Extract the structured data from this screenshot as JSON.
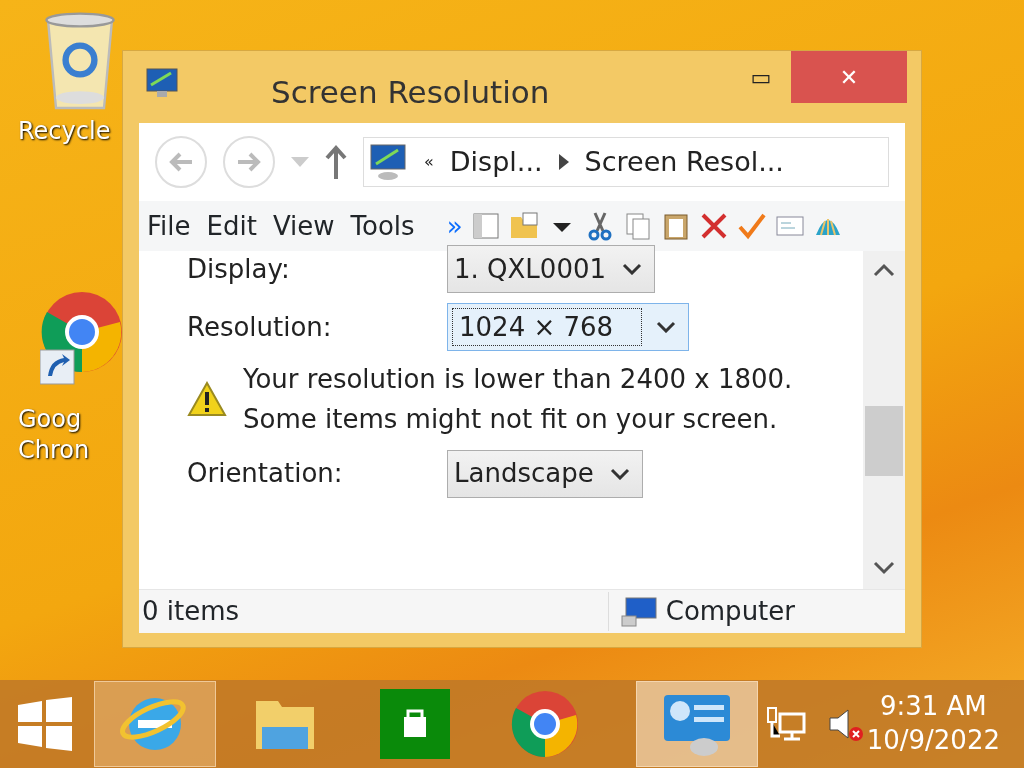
{
  "desktop_icons": [
    {
      "kind": "recycle",
      "lines": [
        "Recycle"
      ]
    },
    {
      "kind": "chrome",
      "lines": [
        "Goog",
        "Chron"
      ]
    }
  ],
  "window": {
    "title": "Screen Resolution",
    "minimize": "▭",
    "close": "✕"
  },
  "address_bar": {
    "overflow": "«",
    "crumbs": [
      "Displ...",
      "Screen Resol..."
    ],
    "back_disabled": true,
    "forward_disabled": true
  },
  "menu": [
    "File",
    "Edit",
    "View",
    "Tools"
  ],
  "toolbar_overflow": "»",
  "settings": [
    {
      "kind": "select",
      "label": "Display:",
      "value": "1. QXL0001",
      "focused": false
    },
    {
      "kind": "select",
      "label": "Resolution:",
      "value": "1024 × 768",
      "focused": true
    },
    {
      "kind": "warning",
      "lines": [
        "Your resolution is lower than 2400 x 1800.",
        "Some items might not fit on your screen."
      ]
    },
    {
      "kind": "select",
      "label": "Orientation:",
      "value": "Landscape",
      "focused": false
    }
  ],
  "status_bar": {
    "items": "0 items",
    "location": "Computer"
  },
  "taskbar": {
    "apps": [
      {
        "kind": "ie",
        "selected": false,
        "highlighted": true
      },
      {
        "kind": "explorer",
        "selected": false,
        "highlighted": false
      },
      {
        "kind": "store",
        "selected": false,
        "highlighted": false
      },
      {
        "kind": "chrome",
        "selected": false,
        "highlighted": false
      },
      {
        "kind": "display",
        "selected": true,
        "highlighted": true
      }
    ],
    "time": "9:31 AM",
    "date": "10/9/2022"
  }
}
